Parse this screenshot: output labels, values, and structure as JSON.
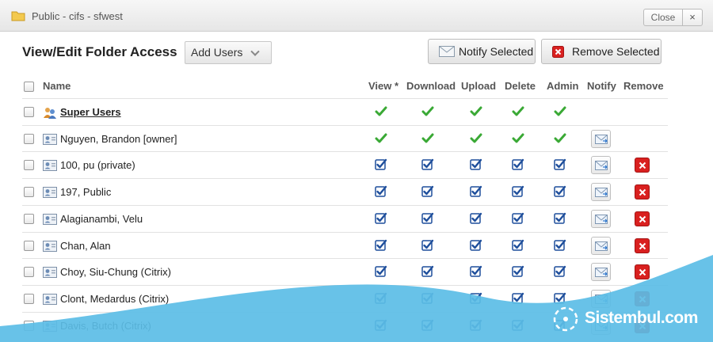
{
  "window": {
    "title": "Public - cifs - sfwest",
    "close_label": "Close",
    "close_x": "×"
  },
  "heading": "View/Edit Folder Access",
  "toolbar": {
    "add_users": "Add Users",
    "notify_selected": "Notify Selected",
    "remove_selected": "Remove Selected"
  },
  "columns": {
    "name": "Name",
    "view": "View *",
    "download": "Download",
    "upload": "Upload",
    "delete": "Delete",
    "admin": "Admin",
    "notify": "Notify",
    "remove": "Remove"
  },
  "rows": [
    {
      "name": "Super Users",
      "type": "group",
      "perm": "check",
      "notify": false,
      "remove": false
    },
    {
      "name": "Nguyen, Brandon [owner]",
      "type": "user",
      "perm": "check",
      "notify": true,
      "remove": false
    },
    {
      "name": "100, pu (private)",
      "type": "user",
      "perm": "box",
      "notify": true,
      "remove": true
    },
    {
      "name": "197, Public",
      "type": "user",
      "perm": "box",
      "notify": true,
      "remove": true
    },
    {
      "name": "Alagianambi, Velu",
      "type": "user",
      "perm": "box",
      "notify": true,
      "remove": true
    },
    {
      "name": "Chan, Alan",
      "type": "user",
      "perm": "box",
      "notify": true,
      "remove": true
    },
    {
      "name": "Choy, Siu-Chung (Citrix)",
      "type": "user",
      "perm": "box",
      "notify": true,
      "remove": true
    },
    {
      "name": "Clont, Medardus (Citrix)",
      "type": "user",
      "perm": "box",
      "notify": true,
      "remove": true
    },
    {
      "name": "Davis, Butch (Citrix)",
      "type": "user",
      "perm": "box",
      "notify": true,
      "remove": true
    }
  ],
  "watermark": {
    "text": "Sistembul.com"
  },
  "colors": {
    "check": "#3aa935",
    "checkbox": "#1f4f9c",
    "remove": "#d9201f",
    "wave": "#5bbde6"
  }
}
